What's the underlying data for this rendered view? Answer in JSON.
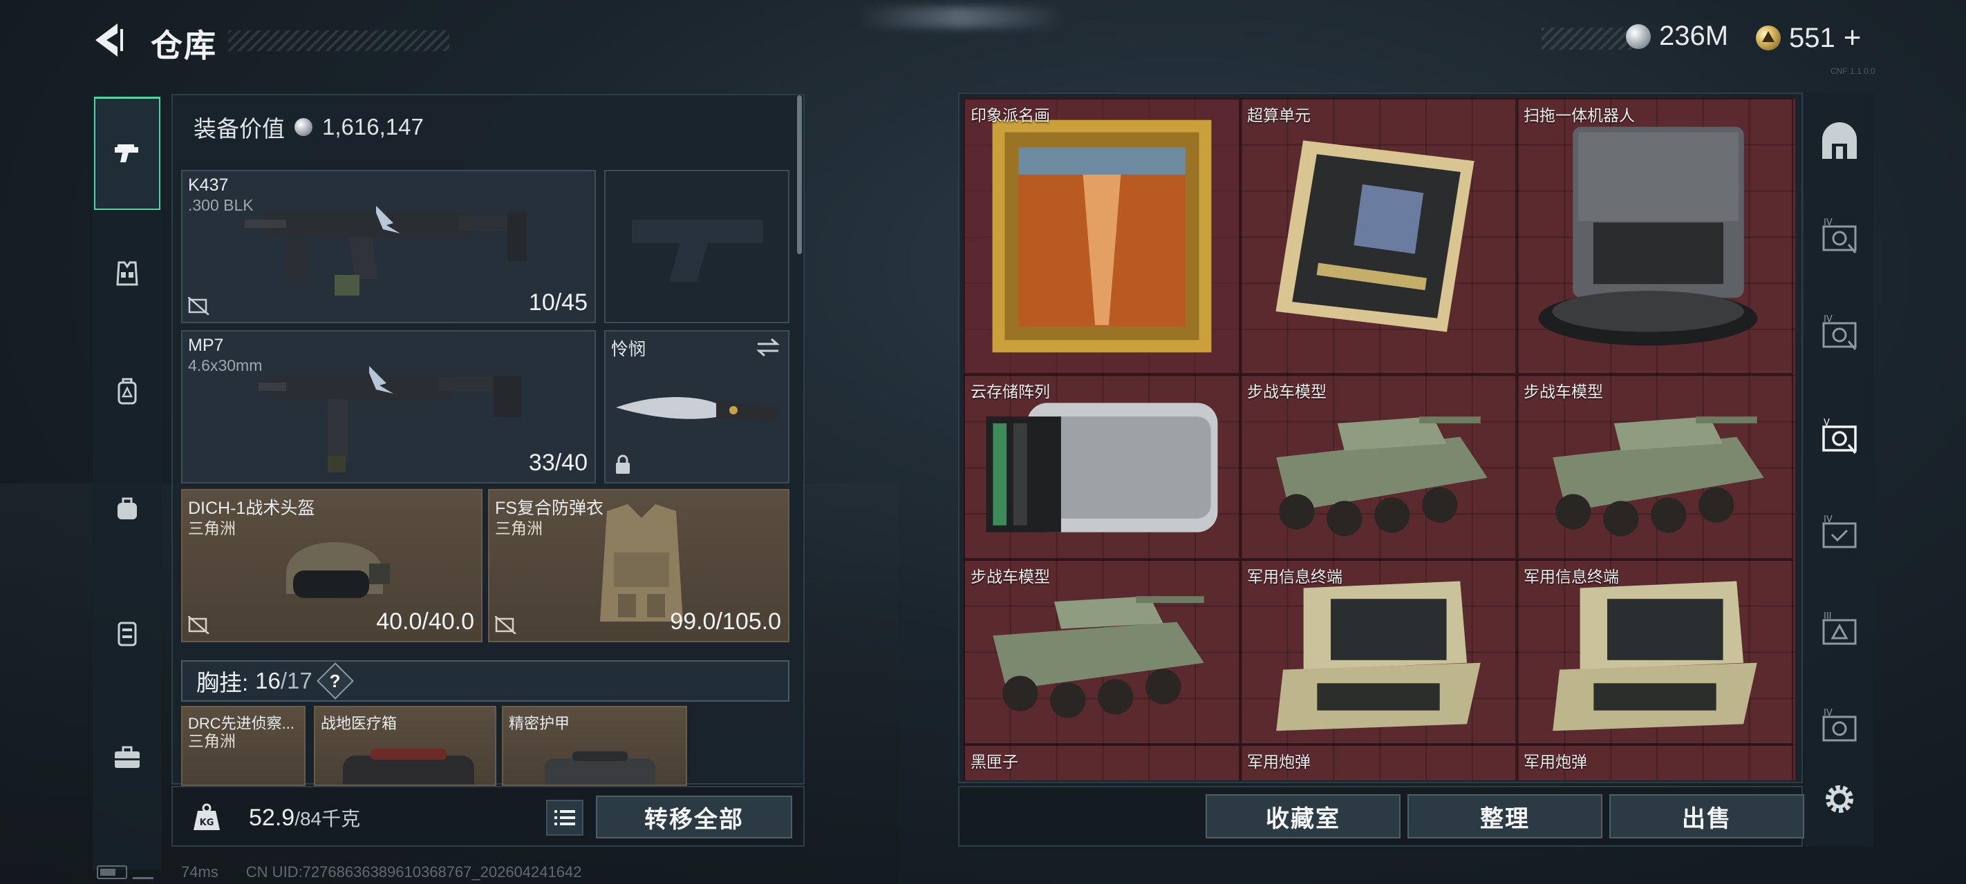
{
  "header": {
    "title": "仓库",
    "currency_silver": "236M",
    "currency_gold": "551",
    "currency_gold_add": "+",
    "corner_tag": "CNF 1.1 0.0"
  },
  "loadout": {
    "equip_value_label": "装备价值",
    "equip_value": "1,616,147",
    "primary": {
      "name": "K437",
      "ammo": ".300 BLK",
      "count": "10/45"
    },
    "secondary": {
      "name": "MP7",
      "ammo": "4.6x30mm",
      "count": "33/40"
    },
    "melee": {
      "name": "怜悯"
    },
    "helmet": {
      "name": "DICH-1战术头盔",
      "origin": "三角洲",
      "durability": "40.0/40.0"
    },
    "armor": {
      "name": "FS复合防弹衣",
      "origin": "三角洲",
      "durability": "99.0/105.0"
    },
    "chest": {
      "label": "胸挂:",
      "current": "16",
      "max": "/17",
      "help": "?"
    },
    "chest_items": [
      {
        "name": "DRC先进侦察...",
        "origin": "三角洲"
      },
      {
        "name": "战地医疗箱"
      },
      {
        "name": "精密护甲"
      }
    ],
    "weight_value": "52.9",
    "weight_max": "/84千克",
    "transfer_all": "转移全部"
  },
  "stash": {
    "items": [
      {
        "name": "印象派名画"
      },
      {
        "name": "超算单元"
      },
      {
        "name": "扫拖一体机器人"
      },
      {
        "name": "云存储阵列"
      },
      {
        "name": "步战车模型"
      },
      {
        "name": "步战车模型"
      },
      {
        "name": "步战车模型"
      },
      {
        "name": "军用信息终端"
      },
      {
        "name": "军用信息终端"
      },
      {
        "name": "黑匣子"
      },
      {
        "name": "军用炮弹"
      },
      {
        "name": "军用炮弹"
      }
    ],
    "buttons": {
      "collection": "收藏室",
      "sort": "整理",
      "sell": "出售"
    }
  },
  "tiers": [
    "",
    "IV",
    "IV",
    "V",
    "IV",
    "III",
    "IV"
  ],
  "status": {
    "ping": "74ms",
    "uid": "CN UID:727686363896103​68767_202604241642"
  },
  "colors": {
    "accent": "#4fd4a4",
    "stash_bg": "#5a2a2f",
    "bronze": "#5a4e40"
  }
}
